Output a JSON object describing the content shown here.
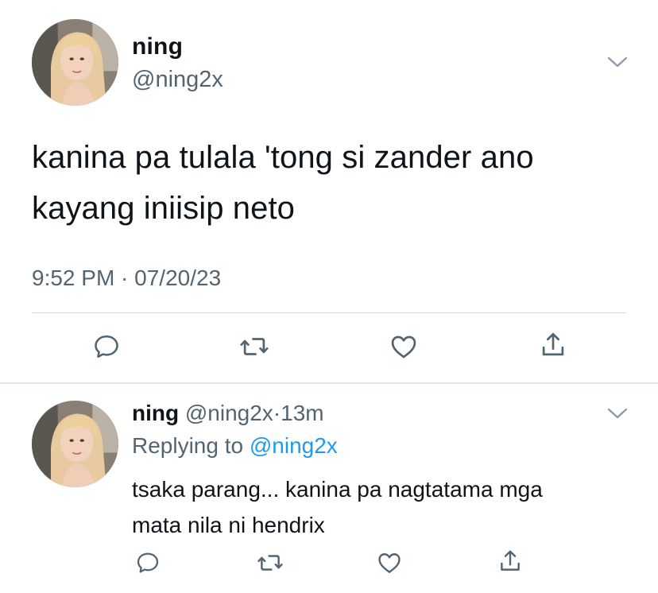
{
  "main_tweet": {
    "display_name": "ning",
    "handle": "@ning2x",
    "text_line1": "kanina pa tulala 'tong si zander ano",
    "text_line2": "kayang iniisip neto",
    "timestamp": "9:52 PM · 07/20/23"
  },
  "reply_tweet": {
    "display_name": "ning",
    "handle": "@ning2x",
    "separator": "·",
    "time_ago": "13m",
    "replying_prefix": "Replying to",
    "replying_handle": "@ning2x",
    "text_line1": "tsaka parang... kanina pa nagtatama mga",
    "text_line2": "mata nila ni hendrix"
  },
  "icons": {
    "reply": "comment-bubble-icon",
    "retweet": "retweet-icon",
    "like": "heart-icon",
    "share": "share-icon",
    "more": "chevron-down-icon"
  },
  "colors": {
    "text": "#0f1419",
    "secondary": "#536471",
    "link": "#1d9bf0",
    "divider": "#cfd9de"
  }
}
